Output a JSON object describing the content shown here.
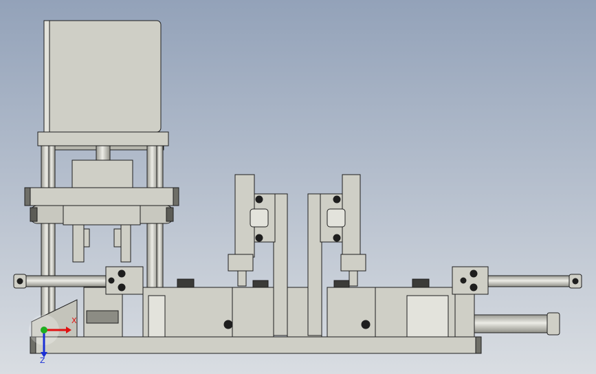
{
  "viewport": {
    "background_top": "#93a2b9",
    "background_bottom": "#d9dde2"
  },
  "model": {
    "part_fill": "#cfcfc6",
    "part_fill_dark": "#b6b6ad",
    "part_fill_light": "#e3e3dc",
    "edge_color": "#1e1e1e",
    "rod_fill": "#d6d6ce"
  },
  "triad": {
    "x_label": "X",
    "z_label": "Z",
    "x_color": "#e01010",
    "z_color": "#1a2fd6",
    "y_color": "#1fae1f"
  }
}
